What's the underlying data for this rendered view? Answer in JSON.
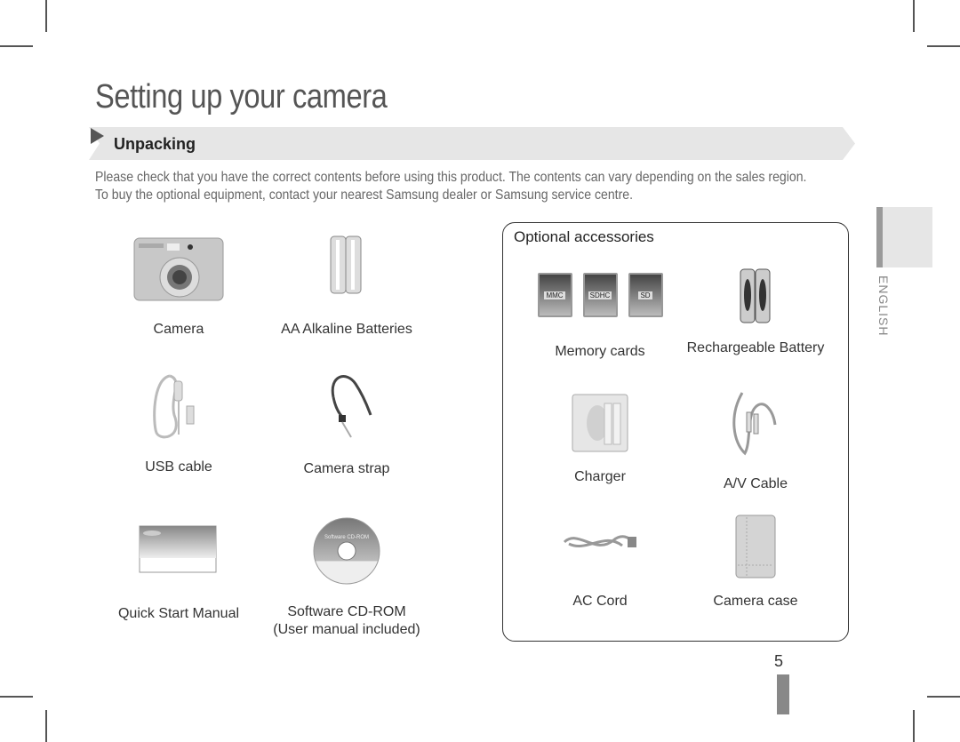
{
  "page": {
    "title": "Setting up your camera",
    "section": "Unpacking",
    "intro_lines": [
      "Please check that you have the correct contents before using this product. The contents can vary depending on the sales region.",
      "To buy the optional equipment, contact your nearest Samsung dealer or Samsung service centre."
    ],
    "side_tab_label": "ENGLISH",
    "page_number": "5"
  },
  "included_items": [
    {
      "label": "Camera",
      "icon": "camera-icon"
    },
    {
      "label": "AA Alkaline Batteries",
      "icon": "batteries-icon"
    },
    {
      "label": "USB cable",
      "icon": "usb-cable-icon"
    },
    {
      "label": "Camera strap",
      "icon": "strap-icon"
    },
    {
      "label": "Quick Start Manual",
      "icon": "manual-icon"
    },
    {
      "label": "Software CD-ROM",
      "sublabel": "(User manual included)",
      "icon": "cd-rom-icon",
      "disc_text": "Software CD-ROM"
    }
  ],
  "optional": {
    "title": "Optional accessories",
    "items": [
      {
        "label": "Memory cards",
        "icon": "memory-cards-icon",
        "cards": [
          "MMC",
          "SDHC",
          "SD"
        ]
      },
      {
        "label": "Rechargeable Battery",
        "icon": "rechargeable-battery-icon"
      },
      {
        "label": "Charger",
        "icon": "charger-icon"
      },
      {
        "label": "A/V Cable",
        "icon": "av-cable-icon"
      },
      {
        "label": "AC Cord",
        "icon": "ac-cord-icon"
      },
      {
        "label": "Camera case",
        "icon": "camera-case-icon"
      }
    ]
  },
  "colors": {
    "band": "#e6e6e6",
    "side_bar": "#9a9a9a",
    "page_bar": "#888888",
    "title": "#555555"
  }
}
